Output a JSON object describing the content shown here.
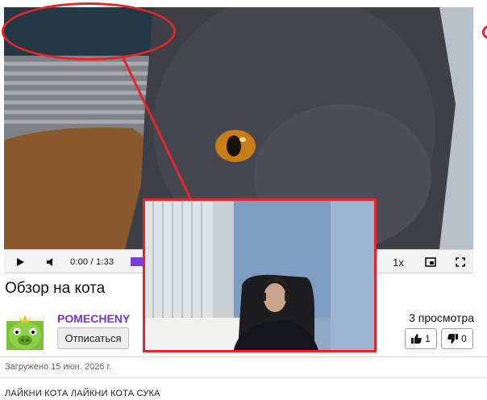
{
  "player": {
    "time_current": "0:00",
    "time_separator": "/",
    "time_total": "1:33",
    "progress_fraction": 0.0,
    "speed": "1x",
    "accent_color": "#7c3bd9",
    "icons": [
      "play-icon",
      "volume-icon",
      "pip-icon",
      "fullscreen-icon"
    ]
  },
  "video": {
    "title": "Обзор на кота"
  },
  "channel": {
    "name": "POMECHENY",
    "unsubscribe_label": "Отписаться",
    "name_color": "#7b2fd0"
  },
  "stats": {
    "views": "3 просмотра",
    "likes": "1",
    "dislikes": "0"
  },
  "upload": {
    "date_text": "Загружено 15 июн. 2026 г."
  },
  "description": {
    "text": "ЛАЙКНИ КОТА ЛАЙКНИ КОТА СУКА"
  },
  "annotation": {
    "color": "#e3262c"
  }
}
